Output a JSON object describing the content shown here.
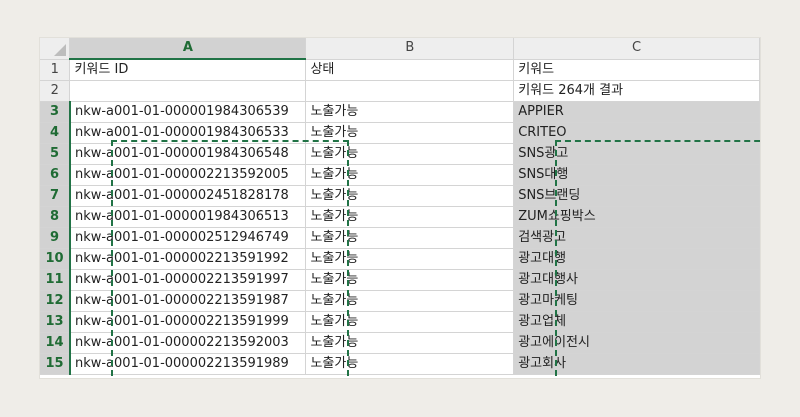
{
  "columns": [
    {
      "letter": "A",
      "selected": true
    },
    {
      "letter": "B",
      "selected": false
    },
    {
      "letter": "C",
      "selected": false
    }
  ],
  "rows": [
    {
      "num": "1",
      "a": "키워드 ID",
      "b": "상태",
      "c": "키워드"
    },
    {
      "num": "2",
      "a": "",
      "b": "",
      "c": "키워드 264개 결과"
    },
    {
      "num": "3",
      "a": "nkw-a001-01-000001984306539",
      "b": "노출가능",
      "c": "APPIER"
    },
    {
      "num": "4",
      "a": "nkw-a001-01-000001984306533",
      "b": "노출가능",
      "c": "CRITEO"
    },
    {
      "num": "5",
      "a": "nkw-a001-01-000001984306548",
      "b": "노출가능",
      "c": "SNS광고"
    },
    {
      "num": "6",
      "a": "nkw-a001-01-000002213592005",
      "b": "노출가능",
      "c": "SNS대행"
    },
    {
      "num": "7",
      "a": "nkw-a001-01-000002451828178",
      "b": "노출가능",
      "c": "SNS브랜딩"
    },
    {
      "num": "8",
      "a": "nkw-a001-01-000001984306513",
      "b": "노출가능",
      "c": "ZUM쇼핑박스"
    },
    {
      "num": "9",
      "a": "nkw-a001-01-000002512946749",
      "b": "노출가능",
      "c": "검색광고"
    },
    {
      "num": "10",
      "a": "nkw-a001-01-000002213591992",
      "b": "노출가능",
      "c": "광고대행"
    },
    {
      "num": "11",
      "a": "nkw-a001-01-000002213591997",
      "b": "노출가능",
      "c": "광고대행사"
    },
    {
      "num": "12",
      "a": "nkw-a001-01-000002213591987",
      "b": "노출가능",
      "c": "광고마케팅"
    },
    {
      "num": "13",
      "a": "nkw-a001-01-000002213591999",
      "b": "노출가능",
      "c": "광고업체"
    },
    {
      "num": "14",
      "a": "nkw-a001-01-000002213592003",
      "b": "노출가능",
      "c": "광고에이전시"
    },
    {
      "num": "15",
      "a": "nkw-a001-01-000002213591989",
      "b": "노출가능",
      "c": "광고회사"
    }
  ],
  "colors": {
    "accent": "#217346",
    "header_bg": "#eeeeee",
    "selected_header_bg": "#d2d2d2",
    "copied_range_bg": "#d3d3d3"
  }
}
